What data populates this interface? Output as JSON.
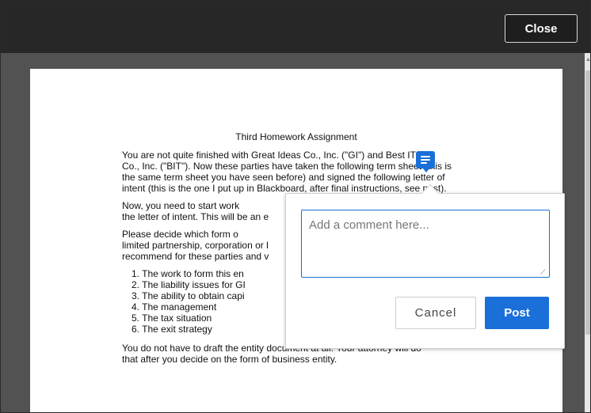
{
  "toolbar": {
    "close_label": "Close"
  },
  "document": {
    "title": "Third Homework Assignment",
    "paragraph1": [
      "        You are not quite finished with Great Ideas Co., Inc. (\"GI\") and Best IT",
      "Co., Inc. (\"BIT\"). Now these parties have taken the following term sheet (this is",
      "the same term sheet you have seen before) and signed the following letter of",
      "intent (this is the one I put up in Blackboard, after final instructions, see post)."
    ],
    "paragraph2": [
      "        Now, you need to start work",
      "the letter of intent. This will be an e"
    ],
    "paragraph3": [
      "        Please decide which form o",
      "limited partnership, corporation or l",
      "recommend for these parties and v"
    ],
    "list": [
      "1.  The work to form this en",
      "2.  The liability issues for GI",
      "3.  The ability to obtain capi",
      "4.  The management",
      "5.  The tax situation",
      "6.  The exit strategy"
    ],
    "paragraph4": [
      "        You do not have to draft the entity document at all. Your attorney will do",
      "that after you decide on the form of business entity."
    ]
  },
  "comment": {
    "marker_icon": "comment-lines-icon",
    "placeholder": "Add a comment here...",
    "value": "",
    "cancel_label": "Cancel",
    "post_label": "Post",
    "accent_color": "#1a6fd8"
  }
}
